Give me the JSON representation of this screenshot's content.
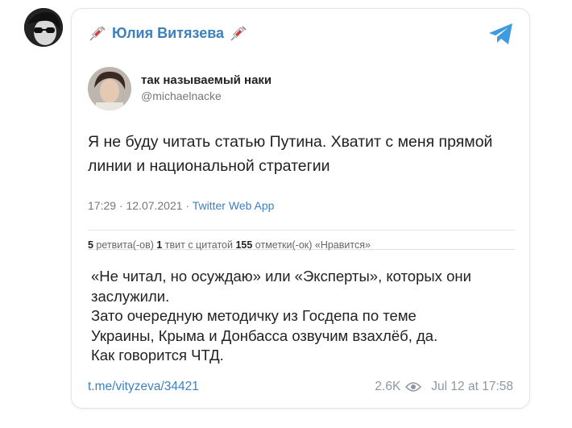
{
  "channel": {
    "author_name": "Юлия Витязева",
    "avatar_icon": "sunglasses-woman-avatar",
    "telegram_icon": "telegram-plane-icon",
    "accent_color": "#3e80bd"
  },
  "tweet": {
    "name": "так называемый наки",
    "handle": "@michaelnacke",
    "text": "Я не буду читать статью Путина. Хватит с меня прямой линии и национальной стратегии",
    "time": "17:29 · 12.07.2021 · ",
    "source": "Twitter Web App",
    "stats": {
      "retweets_count": "5",
      "retweets_label": " ретвита(-ов) ",
      "quotes_count": "1",
      "quotes_label": " твит с цитатой ",
      "likes_count": "155",
      "likes_label": " отметки(-ок) «Нравится»"
    }
  },
  "message": {
    "lines": [
      "«Не читал, но осуждаю» или «Эксперты», которых они",
      "заслужили.",
      "Зато очередную методичку из Госдепа по теме",
      "Украины, Крыма и Донбасса озвучим взахлёб, да.",
      "Как говорится ЧТД."
    ]
  },
  "footer": {
    "link": "t.me/vityzeva/34421",
    "views": "2.6K",
    "date": "Jul 12 at 17:58"
  }
}
